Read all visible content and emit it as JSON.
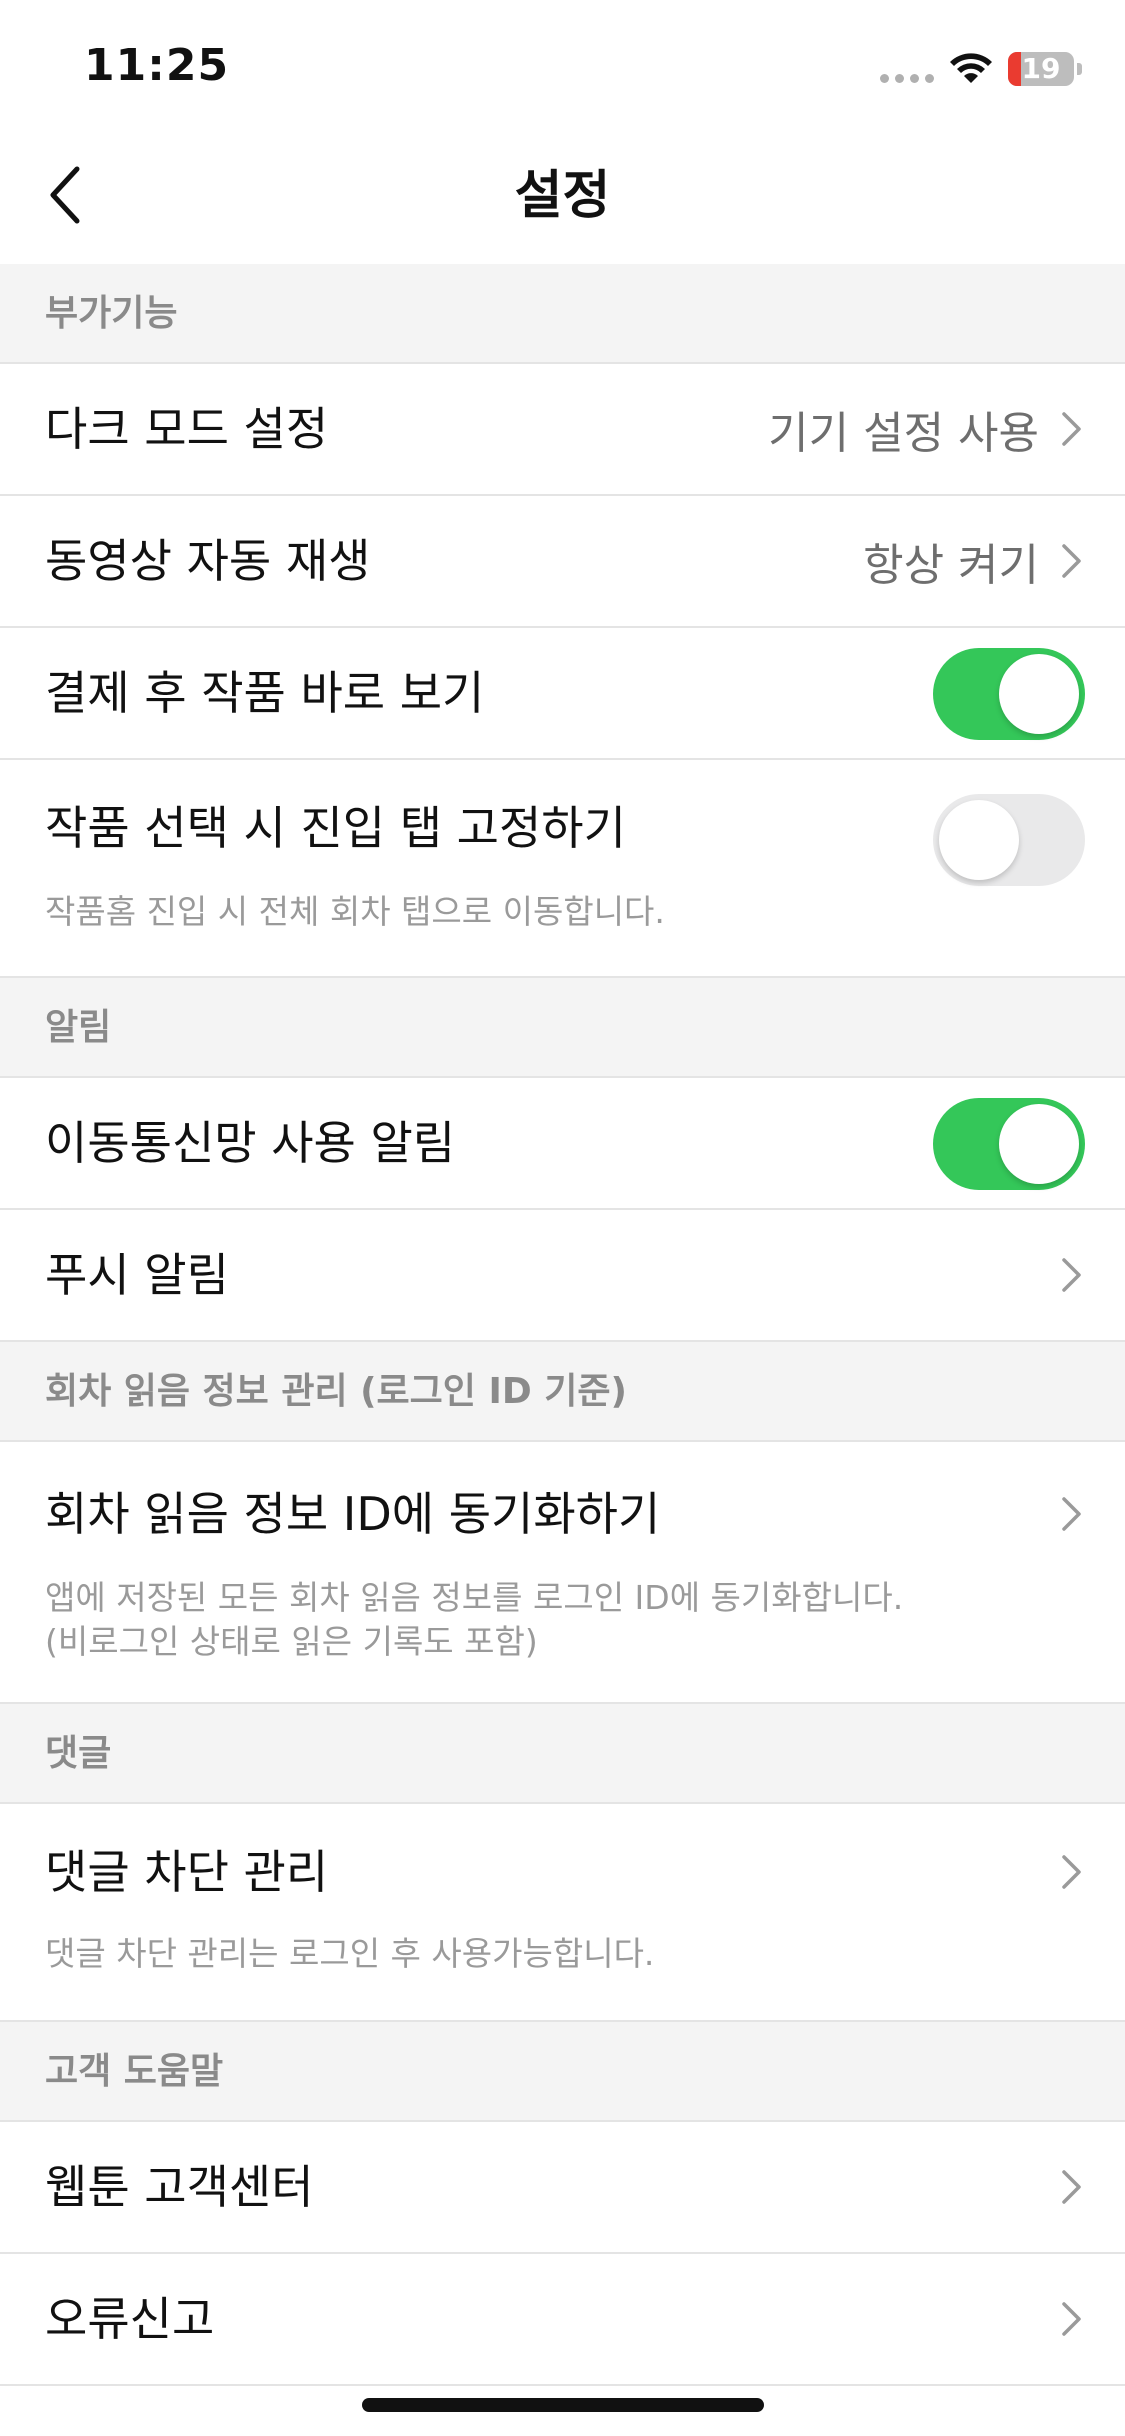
{
  "status_bar": {
    "time": "11:25",
    "battery_level": "19",
    "battery_fraction": 0.19,
    "battery_color": "#ea3b30"
  },
  "nav": {
    "title": "설정",
    "back_icon": "chevron-left-icon"
  },
  "sections": {
    "extra": {
      "header": "부가기능",
      "dark_mode": {
        "title": "다크 모드 설정",
        "value": "기기 설정 사용"
      },
      "video_autoplay": {
        "title": "동영상 자동 재생",
        "value": "항상 켜기"
      },
      "view_after_payment": {
        "title": "결제 후 작품 바로 보기",
        "toggle": true
      },
      "fix_tab": {
        "title": "작품 선택 시 진입 탭 고정하기",
        "subtitle": "작품홈 진입 시 전체 회차 탭으로 이동합니다.",
        "toggle": false
      }
    },
    "notifications": {
      "header": "알림",
      "mobile_data": {
        "title": "이동통신망 사용 알림",
        "toggle": true
      },
      "push": {
        "title": "푸시 알림"
      }
    },
    "reading_info": {
      "header": "회차 읽음 정보 관리 (로그인 ID 기준)",
      "sync": {
        "title": "회차 읽음 정보 ID에 동기화하기",
        "subtitle": "앱에 저장된 모든 회차 읽음 정보를 로그인 ID에 동기화합니다.\n(비로그인 상태로 읽은 기록도 포함)"
      }
    },
    "comments": {
      "header": "댓글",
      "block": {
        "title": "댓글 차단 관리",
        "subtitle": "댓글 차단 관리는 로그인 후 사용가능합니다."
      }
    },
    "support": {
      "header": "고객 도움말",
      "center": {
        "title": "웹툰 고객센터"
      },
      "report": {
        "title": "오류신고"
      }
    }
  },
  "colors": {
    "toggle_on": "#34c759",
    "toggle_off": "#e9e9ea",
    "section_bg": "#f4f4f4",
    "divider": "#e4e4e4"
  }
}
